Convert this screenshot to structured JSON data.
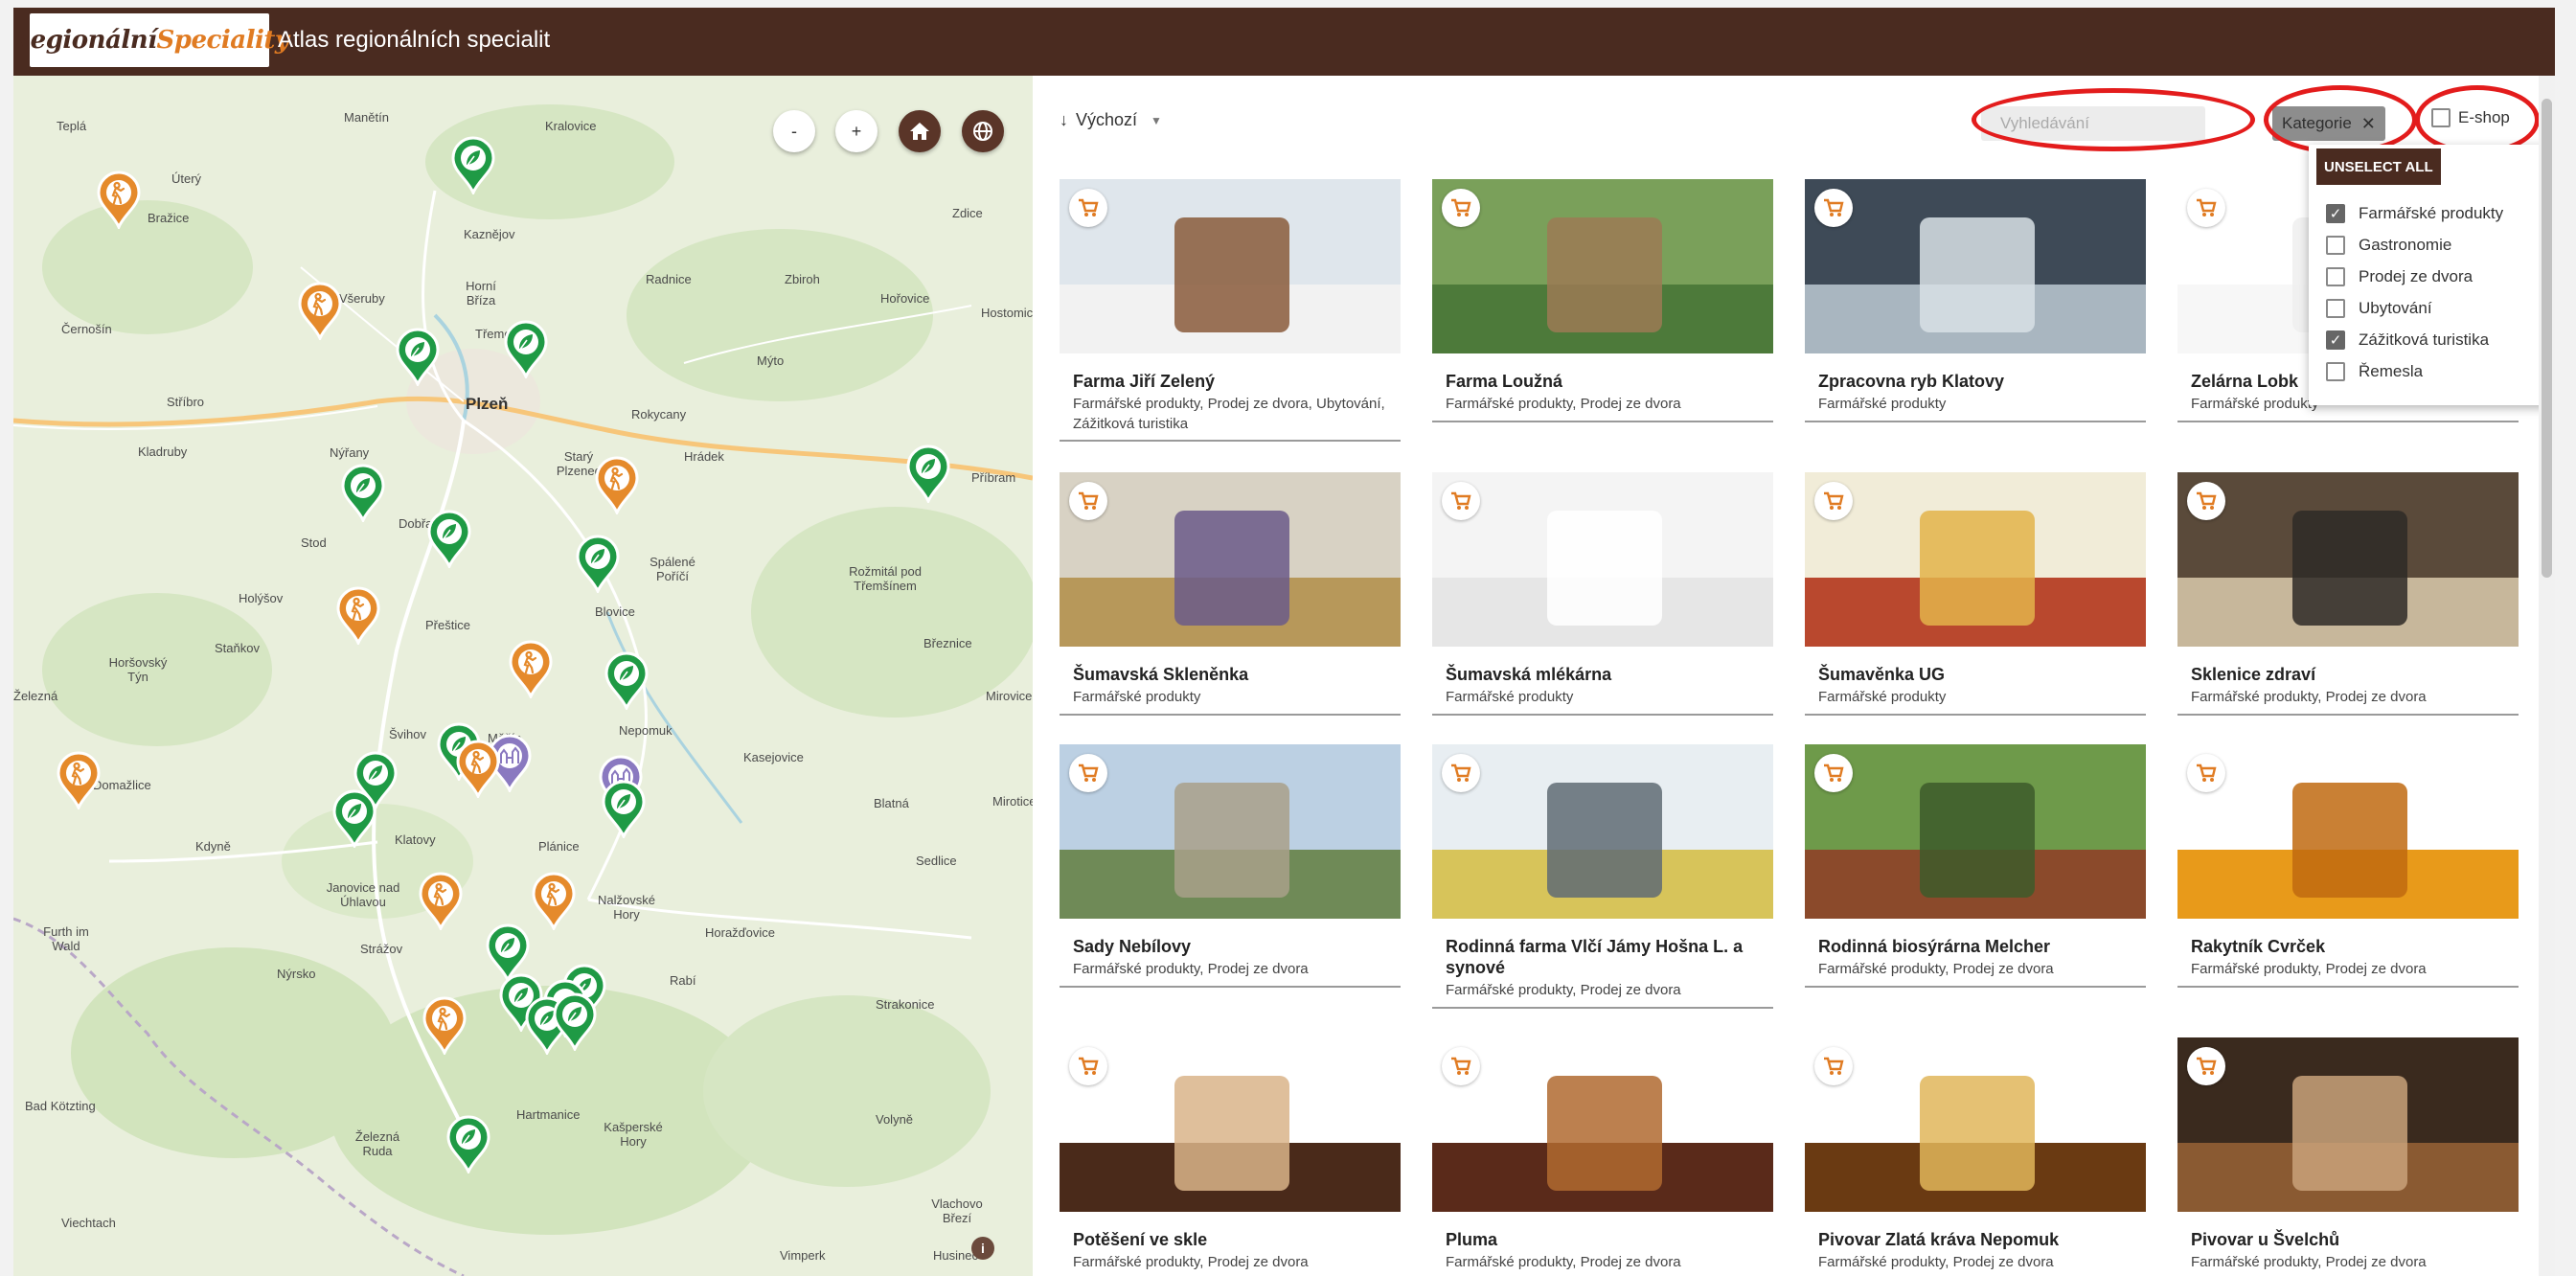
{
  "header": {
    "logo_part1": "Regionální",
    "logo_part2": "Speciality",
    "title": "Atlas regionálních specialit"
  },
  "map": {
    "controls": {
      "zoom_out": "-",
      "zoom_in": "+"
    },
    "attribution": "i",
    "towns": [
      "Teplá",
      "Manětín",
      "Kralovice",
      "Úterý",
      "Bražice",
      "Kaznějov",
      "Zdice",
      "Všeruby",
      "Horní Bříza",
      "Radnice",
      "Zbiroh",
      "Hořovice",
      "Hostomice",
      "Černošín",
      "Třemošná",
      "Mýto",
      "Stříbro",
      "Plzeň",
      "Rokycany",
      "Kladruby",
      "Nýřany",
      "Starý Plzenec",
      "Hrádek",
      "Příbram",
      "Stod",
      "Dobřany",
      "Spálené Poříčí",
      "Rožmitál pod Třemšínem",
      "Holýšov",
      "Přeštice",
      "Blovice",
      "Staňkov",
      "Březnice",
      "Horšovský Týn",
      "Mirovice",
      "Železná",
      "Švihov",
      "Měčín",
      "Nepomuk",
      "Kasejovice",
      "Domažlice",
      "Blatná",
      "Mirotice",
      "Kdyně",
      "Klatovy",
      "Plánice",
      "Sedlice",
      "Janovice nad Úhlavou",
      "Nalžovské Hory",
      "Furth im Wald",
      "Strážov",
      "Horažďovice",
      "Nýrsko",
      "Rabí",
      "Strakonice",
      "Bad Kötzting",
      "Hartmanice",
      "Kašperské Hory",
      "Volyně",
      "Železná Ruda",
      "Vlachovo Březí",
      "Viechtach",
      "Vimperk",
      "Husinec"
    ]
  },
  "toolbar": {
    "sort_label": "Výchozí",
    "search_placeholder": "Vyhledávání",
    "category_chip": "Kategorie",
    "eshop_label": "E-shop",
    "eshop_checked": false
  },
  "category_dropdown": {
    "unselect_all": "UNSELECT ALL",
    "options": [
      {
        "label": "Farmářské produkty",
        "checked": true
      },
      {
        "label": "Gastronomie",
        "checked": false
      },
      {
        "label": "Prodej ze dvora",
        "checked": false
      },
      {
        "label": "Ubytování",
        "checked": false
      },
      {
        "label": "Zážitková turistika",
        "checked": true
      },
      {
        "label": "Řemesla",
        "checked": false
      }
    ]
  },
  "cards": [
    {
      "name": "Farma Jiří Zelený",
      "categories": "Farmářské produkty, Prodej ze dvora, Ubytování, Zážitková turistika"
    },
    {
      "name": "Farma Loužná",
      "categories": "Farmářské produkty, Prodej ze dvora"
    },
    {
      "name": "Zpracovna ryb Klatovy",
      "categories": "Farmářské produkty"
    },
    {
      "name": "Zelárna Lobk",
      "categories": "Farmářské produkty"
    },
    {
      "name": "Šumavská Skleněnka",
      "categories": "Farmářské produkty"
    },
    {
      "name": "Šumavská mlékárna",
      "categories": "Farmářské produkty"
    },
    {
      "name": "Šumavěnka UG",
      "categories": "Farmářské produkty"
    },
    {
      "name": "Sklenice zdraví",
      "categories": "Farmářské produkty, Prodej ze dvora"
    },
    {
      "name": "Sady Nebílovy",
      "categories": "Farmářské produkty, Prodej ze dvora"
    },
    {
      "name": "Rodinná farma Vlčí Jámy Hošna L. a synové",
      "categories": "Farmářské produkty, Prodej ze dvora"
    },
    {
      "name": "Rodinná biosýrárna Melcher",
      "categories": "Farmářské produkty, Prodej ze dvora"
    },
    {
      "name": "Rakytník Cvrček",
      "categories": "Farmářské produkty, Prodej ze dvora"
    },
    {
      "name": "Potěšení ve skle",
      "categories": "Farmářské produkty, Prodej ze dvora"
    },
    {
      "name": "Pluma",
      "categories": "Farmářské produkty, Prodej ze dvora"
    },
    {
      "name": "Pivovar Zlatá kráva Nepomuk",
      "categories": "Farmářské produkty, Prodej ze dvora"
    },
    {
      "name": "Pivovar u Švelchů",
      "categories": "Farmářské produkty, Prodej ze dvora"
    }
  ],
  "colors": {
    "brand_brown": "#4a2b20",
    "accent_orange": "#e07b22",
    "pin_green": "#1f9a45",
    "pin_orange": "#e58a2b",
    "pin_purple": "#8a79c0",
    "highlight_ring": "#e31c1c"
  }
}
